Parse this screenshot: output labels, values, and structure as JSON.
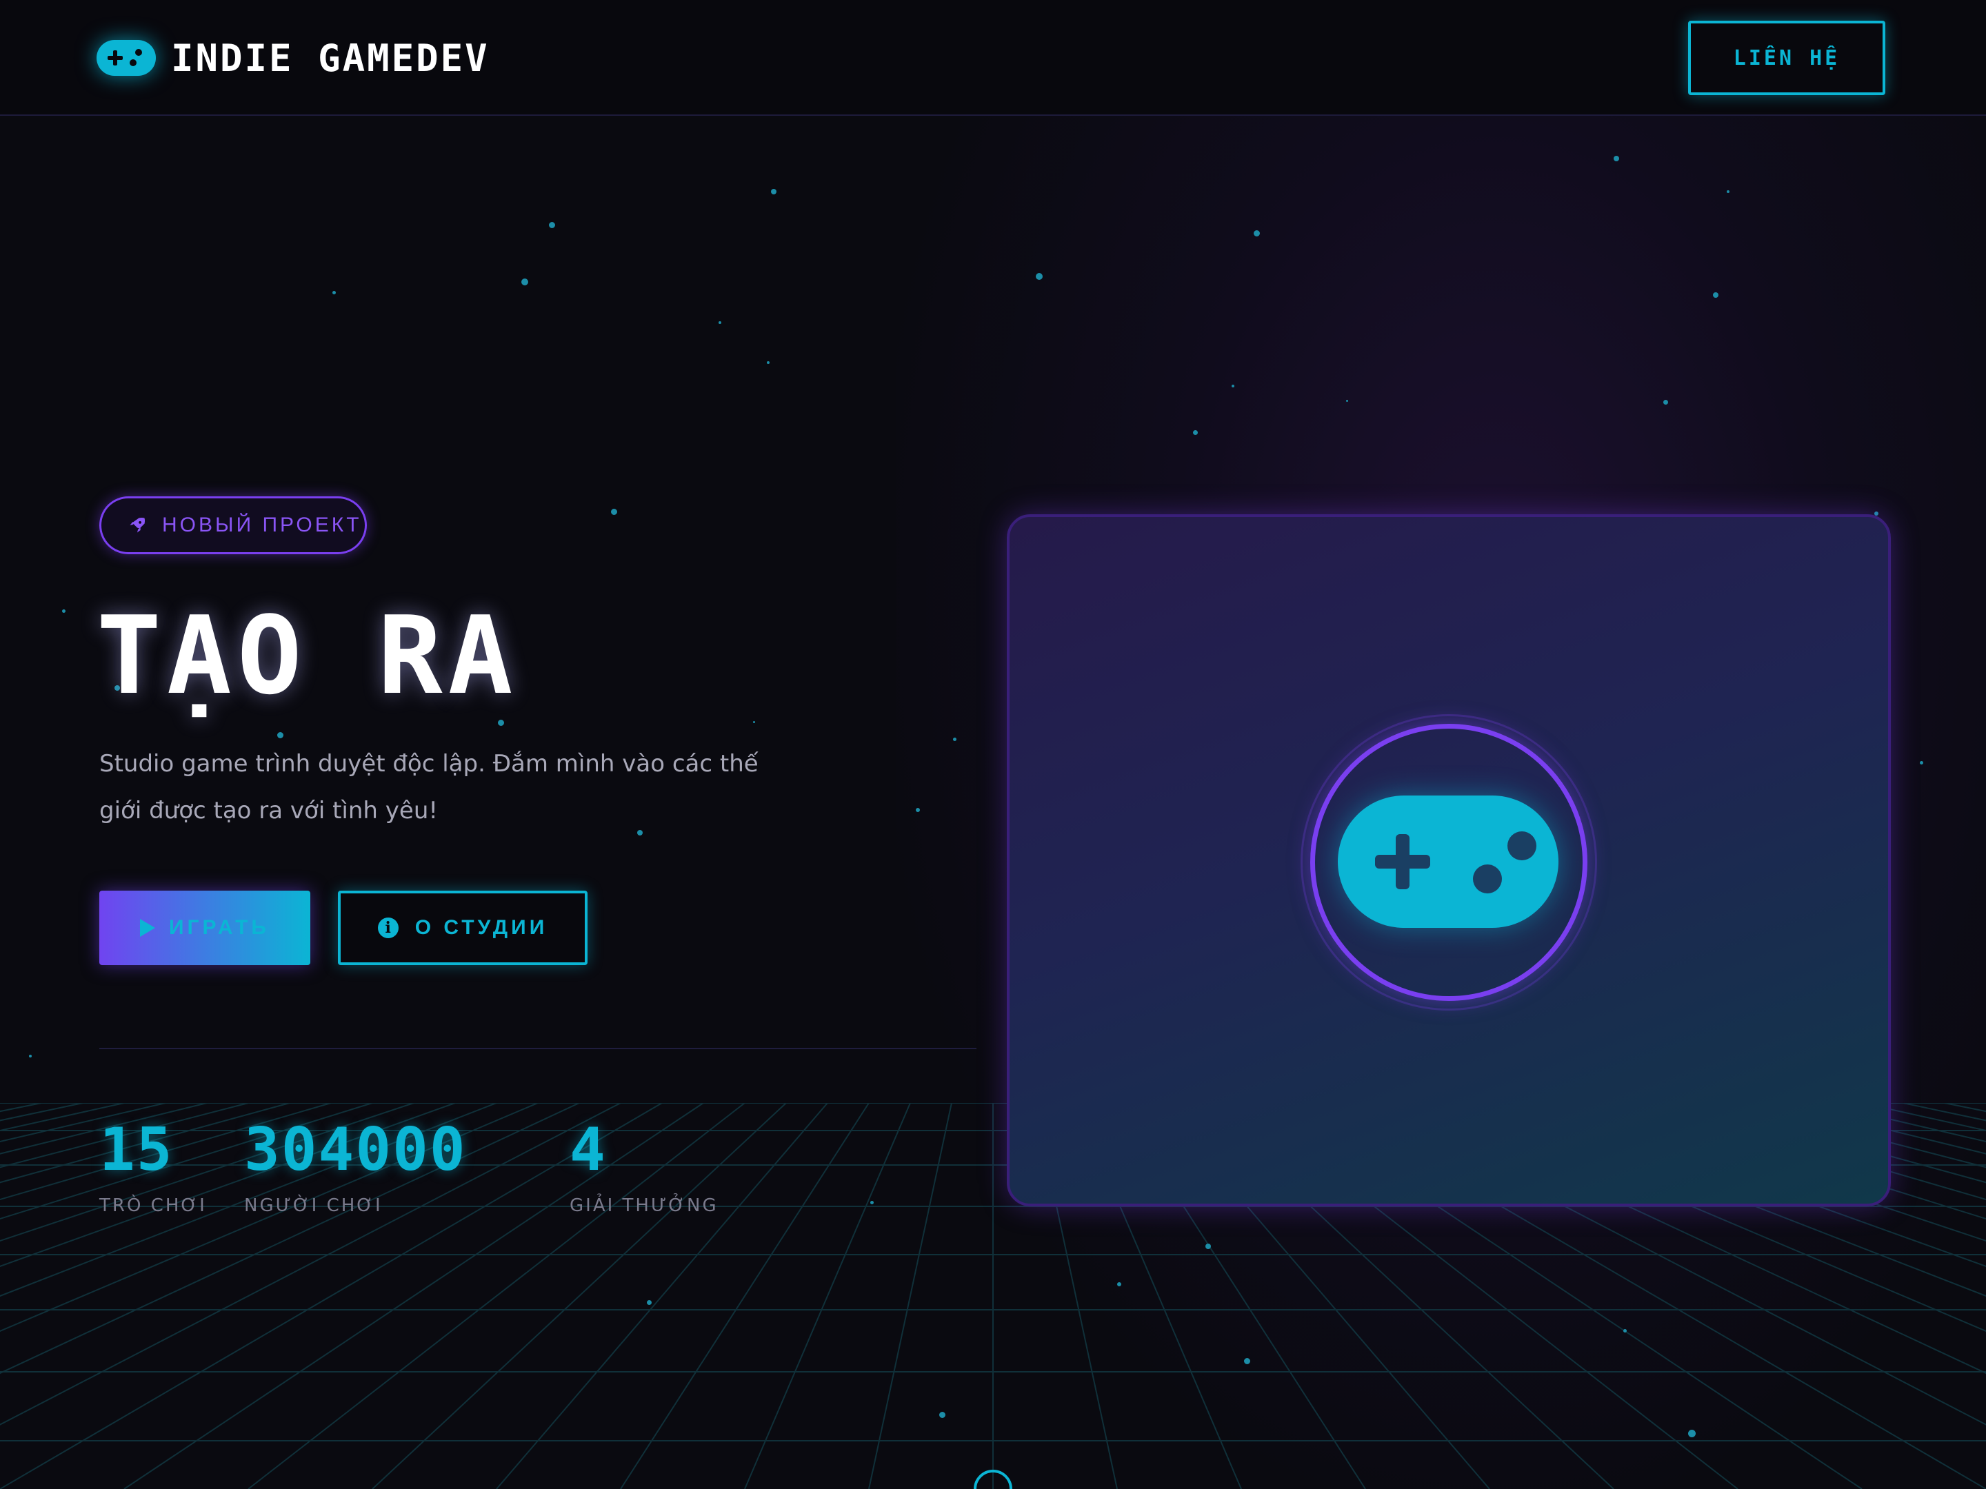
{
  "header": {
    "brand": "INDIE GAMEDEV",
    "contact_label": "LIÊN HỆ"
  },
  "hero": {
    "badge": "НОВЫЙ ПРОЕКТ",
    "title": "TẠO RA",
    "description": "Studio game trình duyệt độc lập. Đắm mình vào các thế giới được tạo ra với tình yêu!",
    "play_label": "ИГРАТЬ",
    "about_label": "О СТУДИИ"
  },
  "stats": [
    {
      "value": "15",
      "label": "TRÒ CHƠI"
    },
    {
      "value": "304000",
      "label": "NGƯỜI CHƠI"
    },
    {
      "value": "4",
      "label": "GIẢI THƯỞNG"
    }
  ],
  "colors": {
    "accent": "#0bb5d4",
    "purple": "#7a3ff0",
    "background": "#0a0a10"
  },
  "icons": [
    "gamepad-icon",
    "rocket-icon",
    "play-icon",
    "info-icon"
  ]
}
